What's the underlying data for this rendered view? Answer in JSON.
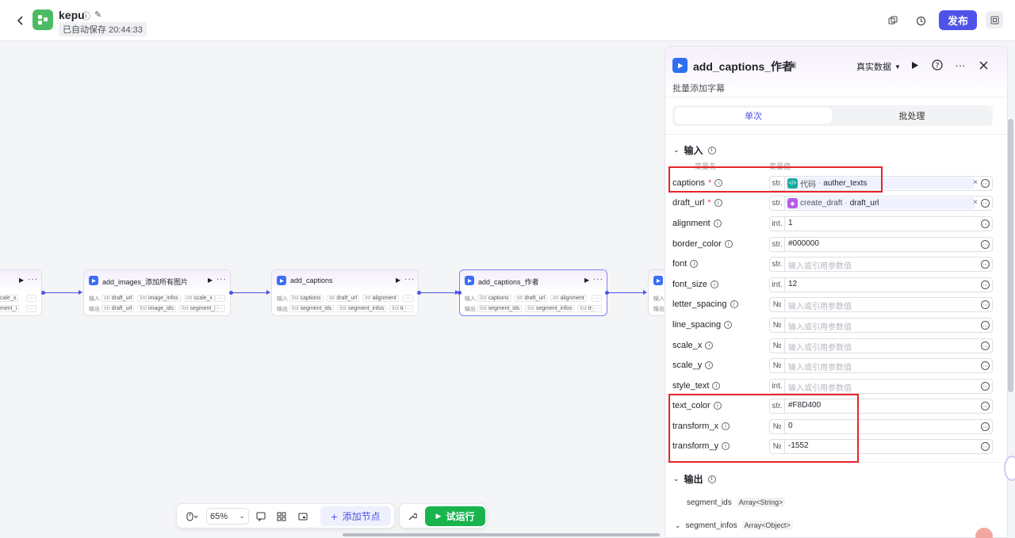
{
  "header": {
    "app_name": "kepu",
    "autosave": "已自动保存 20:44:33",
    "publish_label": "发布"
  },
  "canvas": {
    "nodes": [
      {
        "title": "",
        "in_chips": [
          [
            "",
            "cale_x"
          ]
        ],
        "out_chips": [
          [
            "",
            "ment_i"
          ]
        ]
      },
      {
        "title": "add_images_添加所有图片",
        "in_label": "输入",
        "out_label": "输出",
        "in_chips": [
          [
            "str",
            "draft_url"
          ],
          [
            "list",
            "image_infos"
          ],
          [
            "int",
            "scale_x"
          ]
        ],
        "out_chips": [
          [
            "str",
            "draft_url"
          ],
          [
            "list",
            "image_ids"
          ],
          [
            "list",
            "segment_i"
          ]
        ]
      },
      {
        "title": "add_captions",
        "in_label": "输入",
        "out_label": "输出",
        "in_chips": [
          [
            "list",
            "captions"
          ],
          [
            "str",
            "draft_url"
          ],
          [
            "int",
            "alignment"
          ]
        ],
        "out_chips": [
          [
            "list",
            "segment_ids"
          ],
          [
            "list",
            "segment_infos"
          ],
          [
            "list",
            "tr"
          ]
        ]
      },
      {
        "title": "add_captions_作者",
        "in_label": "输入",
        "out_label": "输出",
        "in_chips": [
          [
            "list",
            "captions"
          ],
          [
            "str",
            "draft_url"
          ],
          [
            "int",
            "alignment"
          ]
        ],
        "out_chips": [
          [
            "list",
            "segment_ids"
          ],
          [
            "list",
            "segment_infos"
          ],
          [
            "list",
            "tr"
          ]
        ]
      },
      {
        "title": "",
        "in_label": "输入",
        "out_label": "输出",
        "in_chips": [],
        "out_chips": []
      }
    ]
  },
  "toolbar": {
    "zoom": "65%",
    "add_node_label": "添加节点",
    "run_label": "试运行"
  },
  "panel": {
    "title": "add_captions_作者",
    "subtitle": "批量添加字幕",
    "data_select": "真实数据",
    "tabs": [
      "单次",
      "批处理"
    ],
    "input_section": "输入",
    "col_name": "变量名",
    "col_value": "变量值",
    "params": [
      {
        "name": "captions",
        "required": true,
        "type": "str.",
        "ref": {
          "source": "代码",
          "var": "auther_texts",
          "color": "#19a9a0"
        }
      },
      {
        "name": "draft_url",
        "required": true,
        "type": "str.",
        "ref": {
          "source": "create_draft",
          "var": "draft_url",
          "color": "#b55de6"
        }
      },
      {
        "name": "alignment",
        "required": false,
        "type": "int.",
        "value": "1"
      },
      {
        "name": "border_color",
        "required": false,
        "type": "str.",
        "value": "#000000"
      },
      {
        "name": "font",
        "required": false,
        "type": "str.",
        "placeholder": "输入或引用参数值"
      },
      {
        "name": "font_size",
        "required": false,
        "type": "int.",
        "value": "12"
      },
      {
        "name": "letter_spacing",
        "required": false,
        "type": "№",
        "placeholder": "输入或引用参数值"
      },
      {
        "name": "line_spacing",
        "required": false,
        "type": "№",
        "placeholder": "输入或引用参数值"
      },
      {
        "name": "scale_x",
        "required": false,
        "type": "№",
        "placeholder": "输入或引用参数值"
      },
      {
        "name": "scale_y",
        "required": false,
        "type": "№",
        "placeholder": "输入或引用参数值"
      },
      {
        "name": "style_text",
        "required": false,
        "type": "int.",
        "placeholder": "输入或引用参数值"
      },
      {
        "name": "text_color",
        "required": false,
        "type": "str.",
        "value": "#F8D400"
      },
      {
        "name": "transform_x",
        "required": false,
        "type": "№",
        "value": "0"
      },
      {
        "name": "transform_y",
        "required": false,
        "type": "№",
        "value": "-1552"
      }
    ],
    "output_section": "输出",
    "outputs": [
      {
        "name": "segment_ids",
        "type": "Array<String>"
      },
      {
        "name": "segment_infos",
        "type": "Array<Object>"
      }
    ]
  },
  "colors": {
    "accent": "#4d53e8",
    "run_green": "#19b44e",
    "highlight_red": "#e8232b"
  }
}
